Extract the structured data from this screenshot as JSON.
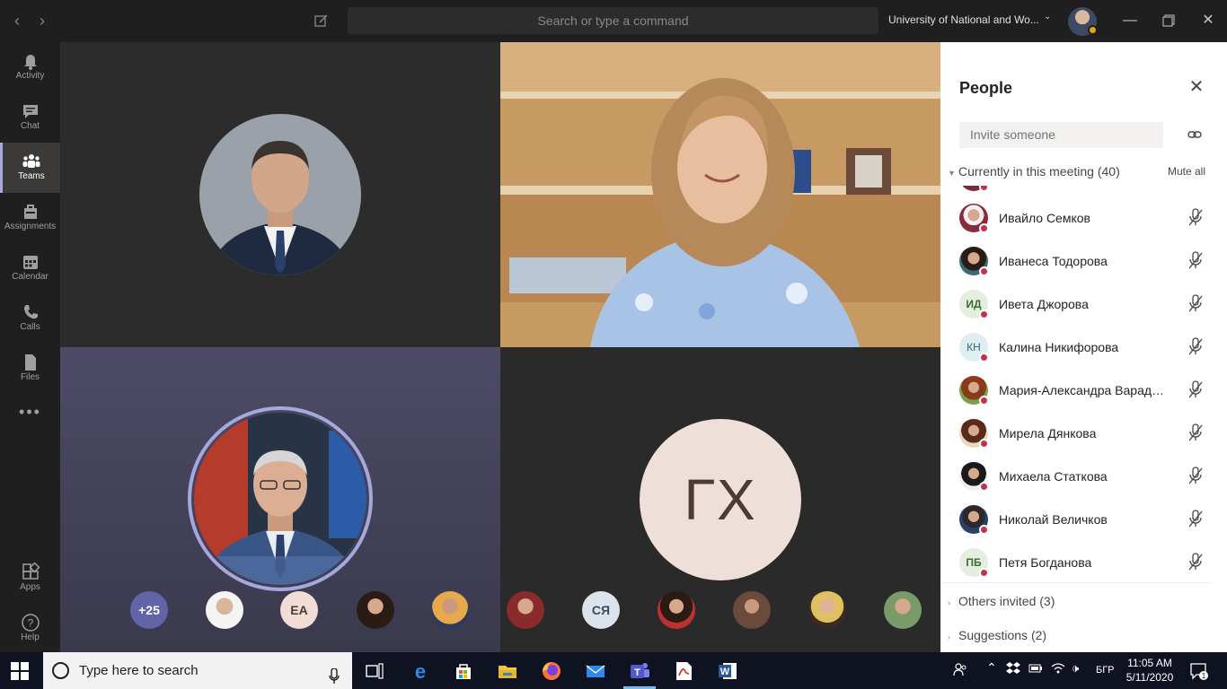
{
  "titlebar": {
    "search_placeholder": "Search or type a command",
    "org_name": "University of National and Wo...",
    "icons": [
      "back-arrow-icon",
      "forward-arrow-icon",
      "compose-icon",
      "chevron-down-icon",
      "minimize-icon",
      "restore-icon",
      "close-icon"
    ]
  },
  "rail": {
    "items": [
      {
        "label": "Activity",
        "icon": "bell-icon"
      },
      {
        "label": "Chat",
        "icon": "chat-icon"
      },
      {
        "label": "Teams",
        "icon": "teams-icon",
        "active": true
      },
      {
        "label": "Assignments",
        "icon": "assignments-icon"
      },
      {
        "label": "Calendar",
        "icon": "calendar-icon"
      },
      {
        "label": "Calls",
        "icon": "phone-icon"
      },
      {
        "label": "Files",
        "icon": "file-icon"
      }
    ],
    "more": "more-apps-icon",
    "bottom": [
      {
        "label": "Apps",
        "icon": "apps-icon"
      },
      {
        "label": "Help",
        "icon": "help-icon"
      }
    ]
  },
  "stage": {
    "tile_bottom_right_initials": "ГХ",
    "overflow": {
      "count_label": "+25",
      "initials_1": "ЕА",
      "initials_2": "СЯ"
    }
  },
  "people": {
    "title": "People",
    "invite_placeholder": "Invite someone",
    "current_section": "Currently in this meeting (40)",
    "mute_all": "Mute all",
    "participants": [
      {
        "name": "Ивайло Семков",
        "initials": "",
        "photo": true,
        "muted": true
      },
      {
        "name": "Иванеса Тодорова",
        "initials": "",
        "photo": true,
        "muted": true
      },
      {
        "name": "Ивета Джорова",
        "initials": "ИД",
        "photo": false,
        "muted": true
      },
      {
        "name": "Калина Никифорова",
        "initials": "КН",
        "photo": false,
        "muted": true
      },
      {
        "name": "Мария-Александра Варадинова",
        "initials": "",
        "photo": true,
        "muted": true
      },
      {
        "name": "Мирела Дянкова",
        "initials": "",
        "photo": true,
        "muted": true
      },
      {
        "name": "Михаела Статкова",
        "initials": "",
        "photo": true,
        "muted": true
      },
      {
        "name": "Николай Величков",
        "initials": "",
        "photo": true,
        "muted": true
      },
      {
        "name": "Петя Богданова",
        "initials": "ПБ",
        "photo": false,
        "muted": true
      }
    ],
    "others_invited": "Others invited (3)",
    "suggestions": "Suggestions (2)"
  },
  "taskbar": {
    "search_placeholder": "Type here to search",
    "language": "БГР",
    "time": "11:05 AM",
    "date": "5/11/2020",
    "notification_count": "1"
  },
  "colors": {
    "accent": "#a6a7dc",
    "presence_busy": "#c4314b",
    "rail_bg": "#201f1f",
    "taskbar_bg": "#0f1220"
  }
}
